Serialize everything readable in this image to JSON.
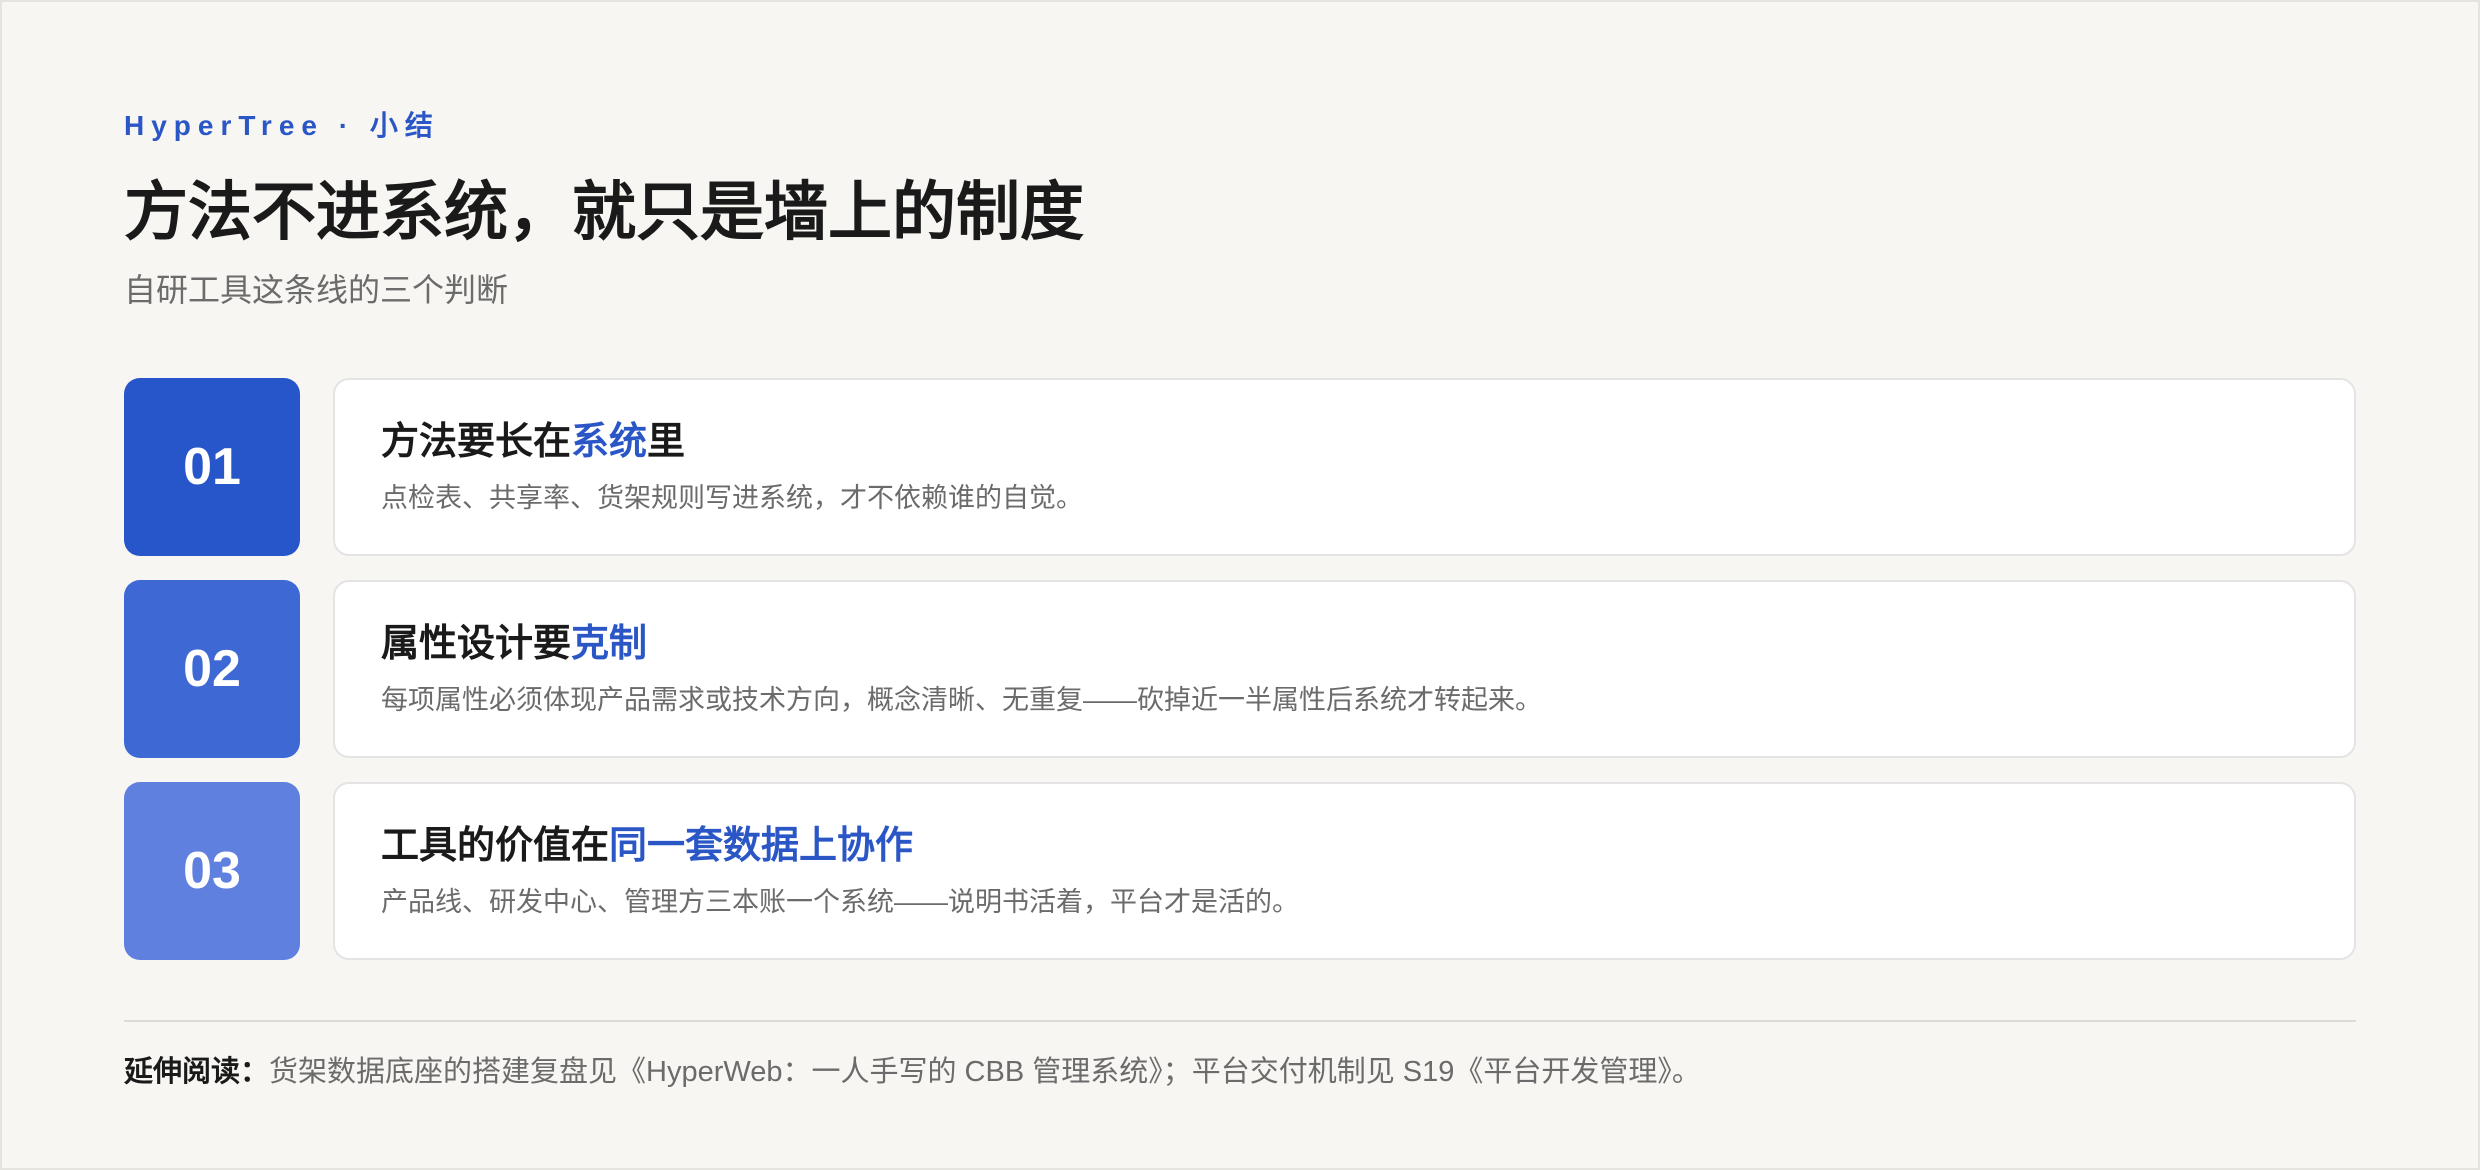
{
  "header": {
    "eyebrow": "HyperTree · 小结",
    "title": "方法不进系统，就只是墙上的制度",
    "subtitle": "自研工具这条线的三个判断"
  },
  "colors": {
    "accent": "#2a56c6",
    "badge_1": "#2656c9",
    "badge_2": "#3e68d4",
    "badge_3": "#5f80df"
  },
  "items": [
    {
      "number": "01",
      "title_prefix": "方法要长在",
      "title_highlight": "系统",
      "title_suffix": "里",
      "description": "点检表、共享率、货架规则写进系统，才不依赖谁的自觉。"
    },
    {
      "number": "02",
      "title_prefix": "属性设计要",
      "title_highlight": "克制",
      "title_suffix": "",
      "description": "每项属性必须体现产品需求或技术方向，概念清晰、无重复——砍掉近一半属性后系统才转起来。"
    },
    {
      "number": "03",
      "title_prefix": "工具的价值在",
      "title_highlight": "同一套数据上协作",
      "title_suffix": "",
      "description": "产品线、研发中心、管理方三本账一个系统——说明书活着，平台才是活的。"
    }
  ],
  "footer": {
    "lead": "延伸阅读：",
    "text": "货架数据底座的搭建复盘见《HyperWeb：一人手写的 CBB 管理系统》；平台交付机制见 S19《平台开发管理》。"
  }
}
